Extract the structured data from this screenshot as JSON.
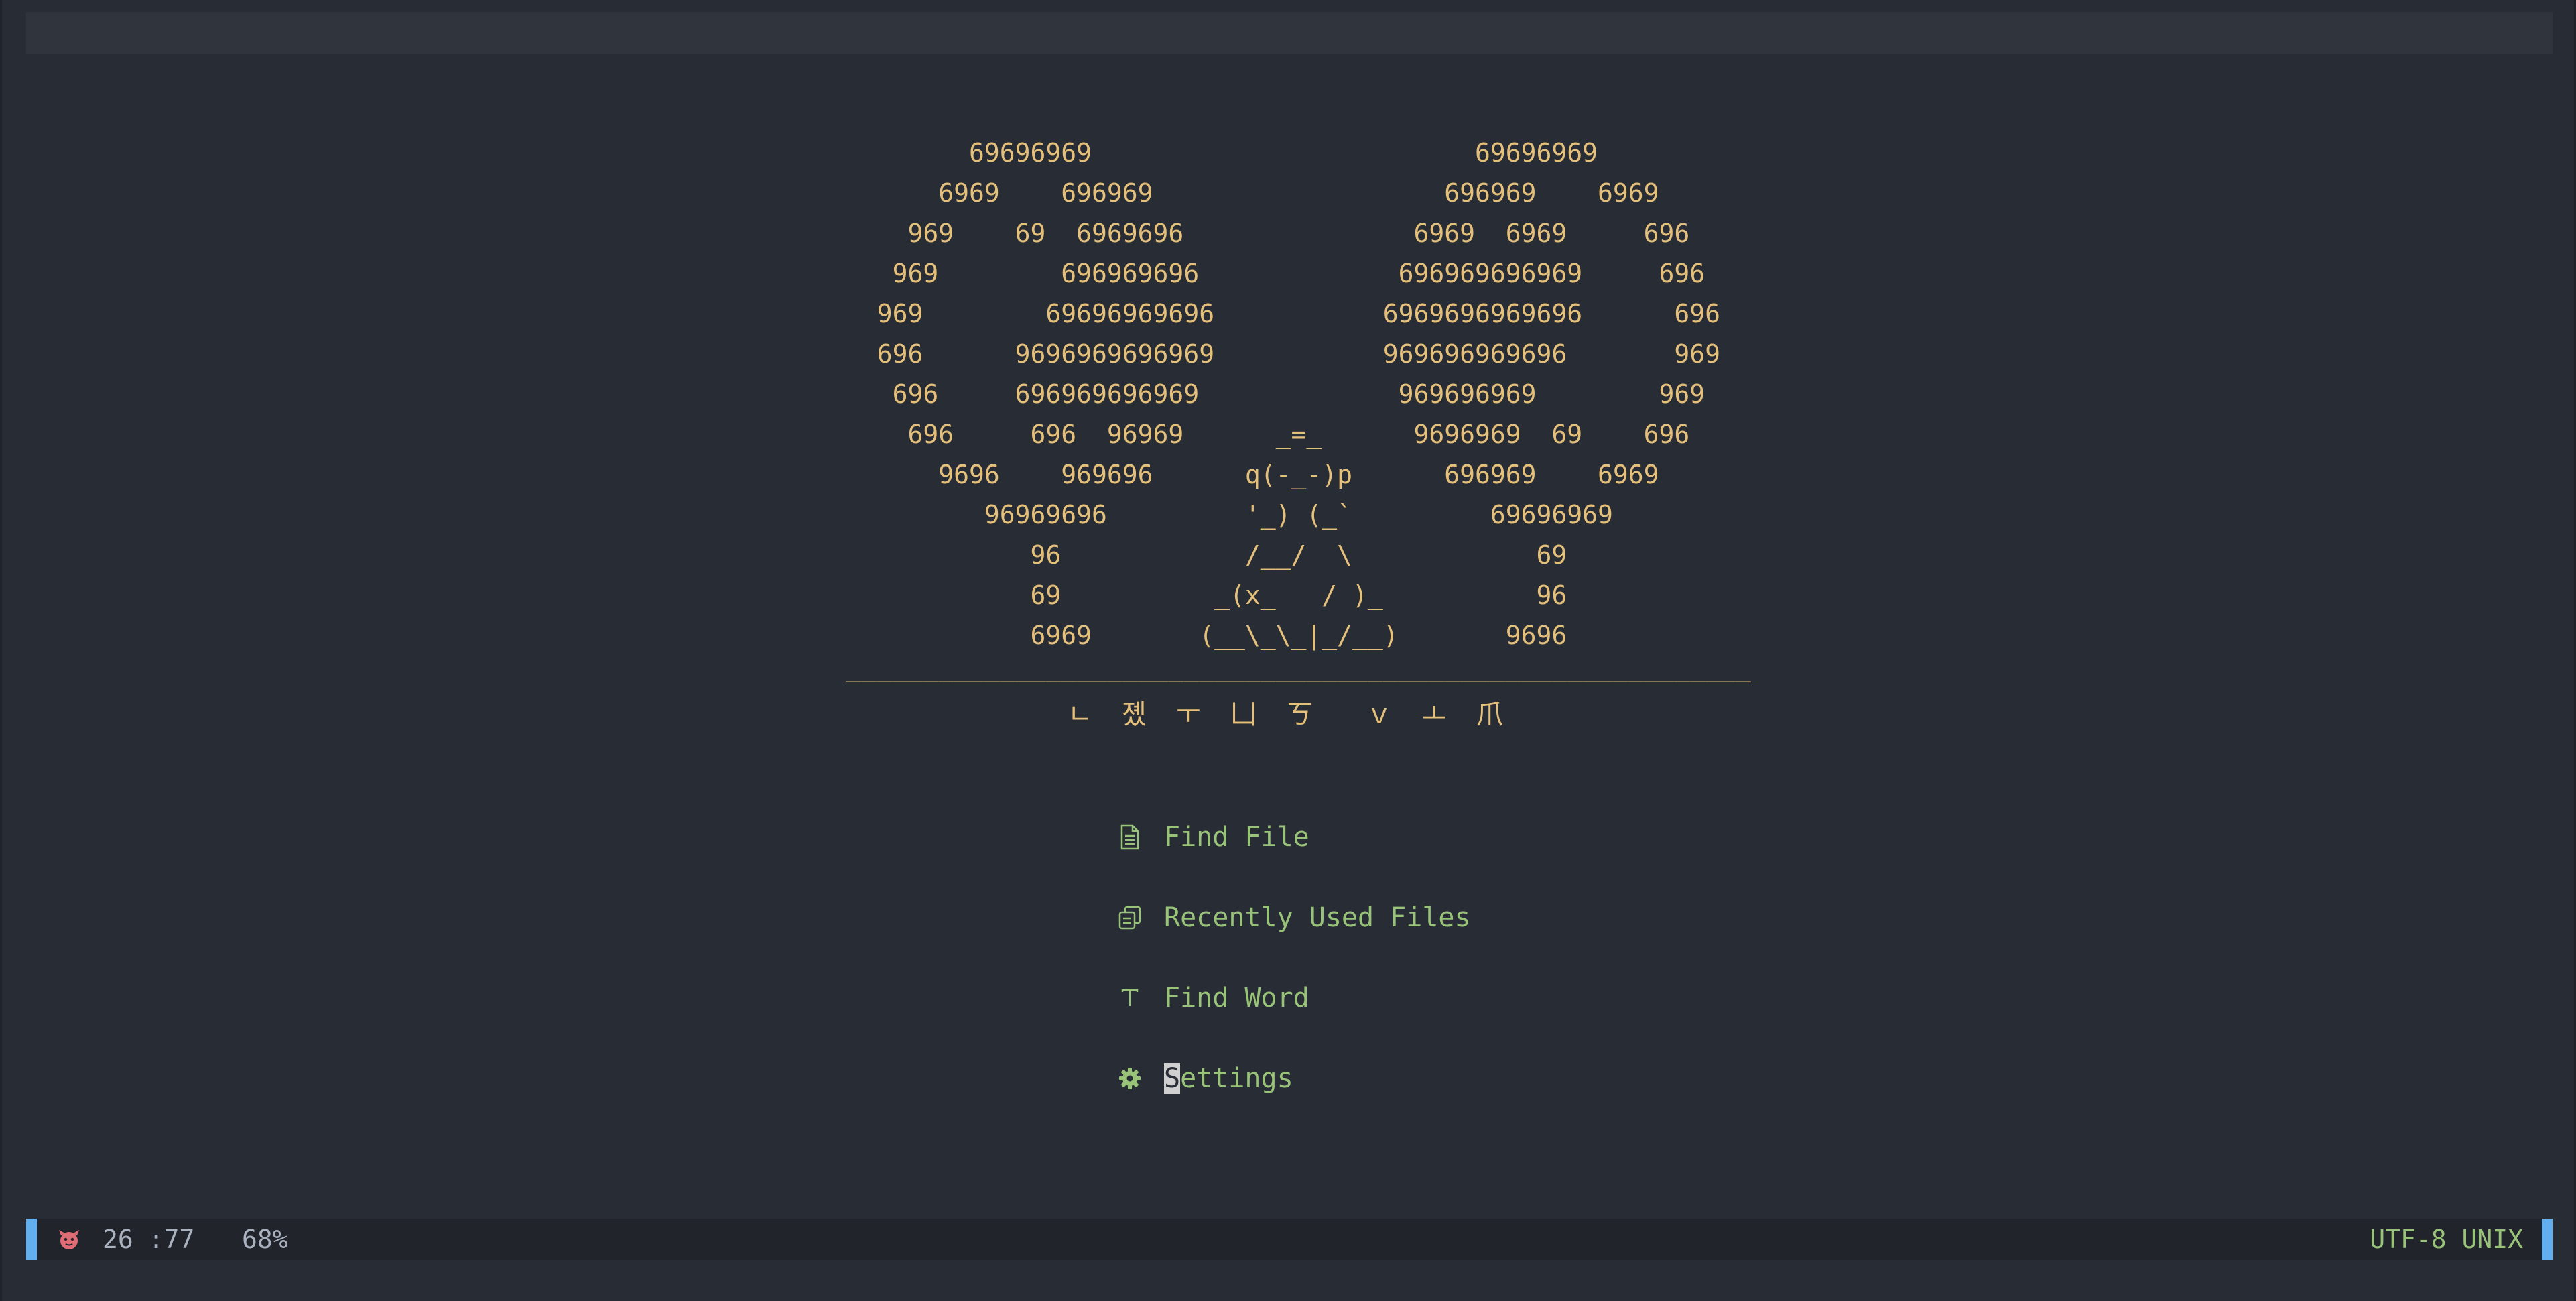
{
  "dashboard": {
    "header_lines": [
      "        69696969                         69696969",
      "      6969    696969                   696969    6969",
      "    969    69  6969696               6969  6969     696",
      "   969        696969696             696969696969     696",
      "  969        69696969696           6969696969696      696",
      "  696      9696969696969           969696969696       969",
      "   696     696969696969             969696969        969",
      "    696     696  96969      _=_      9696969  69    696",
      "      9696    969696      q(-_-)p      696969    6969",
      "         96969696         '_) (_`         69696969",
      "            96            /__/  \\            69",
      "            69          _(x_   / )_          96",
      "            6969       (__\\_\\_|_/__)       9696",
      "___________________________________________________________"
    ],
    "title": "ㄴ 졨 ㅜ 凵 ㄎ  ｖ ㅗ 爪",
    "menu": [
      {
        "icon": "file-icon",
        "label": "Find File"
      },
      {
        "icon": "copy-icon",
        "label": "Recently Used Files"
      },
      {
        "icon": "text-icon",
        "label": "Find Word"
      },
      {
        "icon": "gear-icon",
        "label": "Settings"
      }
    ],
    "cursor_char": "S",
    "settings_rest": "ettings"
  },
  "statusline": {
    "mode_icon": "ghost-icon",
    "position": "26 :77",
    "percent": "68%",
    "encoding": "UTF-8 UNIX"
  },
  "colors": {
    "background": "#282c34",
    "art": "#e5c07b",
    "menu": "#98c379",
    "accent": "#61afef",
    "mode_icon": "#e06c75"
  }
}
